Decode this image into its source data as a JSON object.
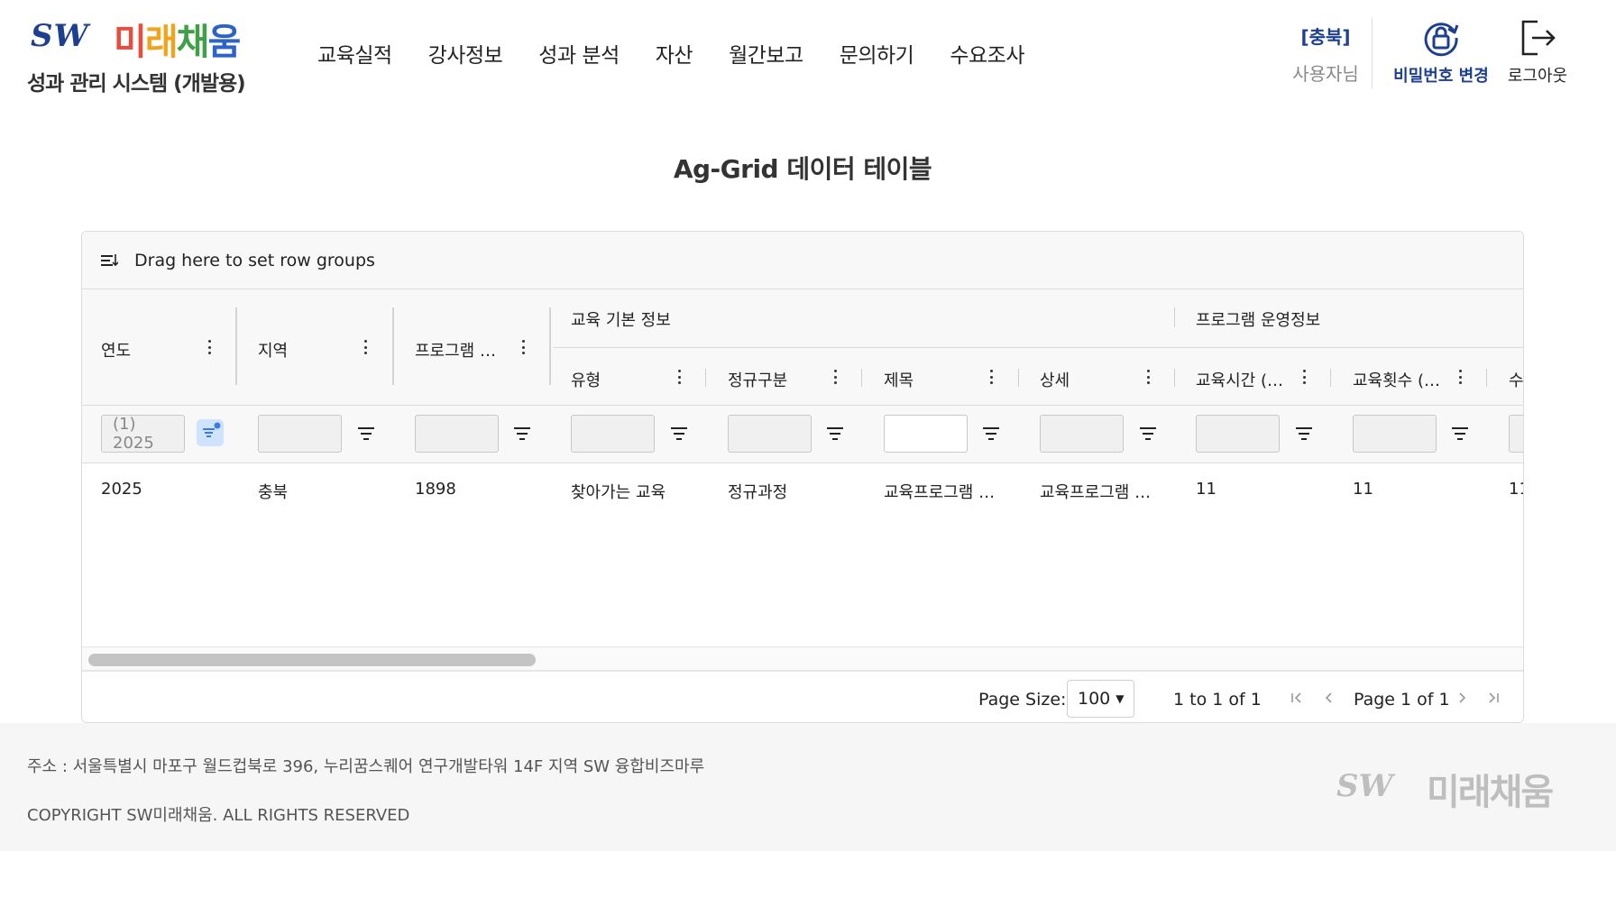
{
  "header": {
    "logo_sw": "SW",
    "logo_kr": [
      "미",
      "래",
      "채",
      "움"
    ],
    "subtitle": "성과 관리 시스템 (개발용)",
    "nav": [
      "교육실적",
      "강사정보",
      "성과 분석",
      "자산",
      "월간보고",
      "문의하기",
      "수요조사"
    ],
    "user_region": "[충북]",
    "user_name": "사용자님",
    "change_password": "비밀번호 변경",
    "logout": "로그아웃"
  },
  "page": {
    "title": "Ag-Grid 데이터 테이블"
  },
  "grid": {
    "group_bar_text": "Drag here to set row groups",
    "group_headers": [
      "교육 기본 정보",
      "프로그램 운영정보"
    ],
    "columns": [
      "연도",
      "지역",
      "프로그램 …",
      "유형",
      "정규구분",
      "제목",
      "상세",
      "교육시간 (…",
      "교육횟수 (…",
      "수"
    ],
    "filter_year_value": "(1) 2025",
    "rows": [
      [
        "2025",
        "충북",
        "1898",
        "찾아가는 교육",
        "정규과정",
        "교육프로그램 …",
        "교육프로그램 …",
        "11",
        "11",
        "11"
      ]
    ],
    "pagination": {
      "page_size_label": "Page Size:",
      "page_size": "100",
      "range": "1 to 1 of 1",
      "page_info": "Page 1 of 1"
    }
  },
  "footer": {
    "address": "주소 : 서울특별시 마포구 월드컵북로 396, 누리꿈스퀘어 연구개발타워 14F 지역 SW 융합비즈마루",
    "copyright": "COPYRIGHT SW미래채움. ALL RIGHTS RESERVED",
    "logo_sw": "SW",
    "logo_kr": "미래채움"
  },
  "colors": {
    "brand_blue": "#1d3f8f",
    "filter_active_bg": "#cfe3ff",
    "scroll_thumb": "#c4c4c4"
  }
}
